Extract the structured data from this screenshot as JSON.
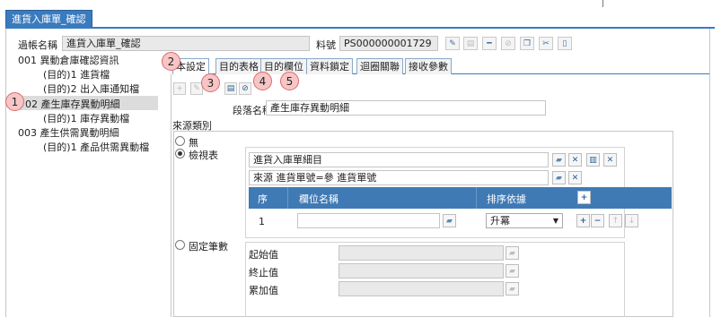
{
  "window": {
    "title": "進貨入庫單_確認"
  },
  "header": {
    "account_name_label": "過帳名稱",
    "account_name_value": "進貨入庫單_確認",
    "material_no_label": "料號",
    "material_no_value": "PS000000001729"
  },
  "tree": {
    "items": [
      {
        "label": "001 異動倉庫確認資訊"
      },
      {
        "label": "(目的)1 進貨檔"
      },
      {
        "label": "(目的)2 出入庫通知檔"
      },
      {
        "label": "02 產生庫存異動明細"
      },
      {
        "label": "(目的)1 庫存異動檔"
      },
      {
        "label": "003 產生供需異動明細"
      },
      {
        "label": "(目的)1 產品供需異動檔"
      }
    ]
  },
  "tabs": [
    {
      "label": "本設定"
    },
    {
      "label": "目的表格"
    },
    {
      "label": "目的欄位"
    },
    {
      "label": "資料鎖定"
    },
    {
      "label": "迴圈關聯"
    },
    {
      "label": "接收參數"
    }
  ],
  "badges": [
    "1",
    "2",
    "3",
    "4",
    "5"
  ],
  "section": {
    "name_label": "段落名稱",
    "name_value": "產生庫存異動明細",
    "source_type_label": "來源類別",
    "radio_none": "無",
    "radio_view": "檢視表",
    "radio_fixed": "固定筆數",
    "view_value": "進貨入庫單細目",
    "source_value": "來源 進貨單號=參 進貨單號"
  },
  "grid": {
    "columns": [
      "序",
      "欄位名稱",
      "排序依據"
    ],
    "rows": [
      {
        "seq": "1",
        "field": "",
        "order": "升冪"
      }
    ]
  },
  "fixed": {
    "start_label": "起始值",
    "end_label": "終止值",
    "step_label": "累加值"
  },
  "colors": {
    "accent": "#3a7bbf",
    "badge_fill": "#f6c6c6",
    "badge_stroke": "#e06868"
  }
}
